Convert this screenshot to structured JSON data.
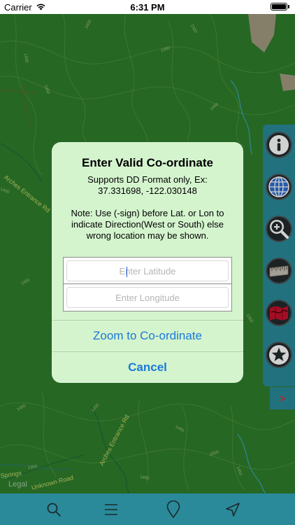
{
  "status_bar": {
    "carrier": "Carrier",
    "time": "6:31 PM",
    "battery_level": 1.0,
    "wifi_icon": "wifi-icon",
    "battery_icon": "battery-icon"
  },
  "map": {
    "road_labels": [
      "Arches Entrance Rd",
      "Arches Entrance Rd",
      "Unknown Road",
      "Springs"
    ],
    "legal": "Legal",
    "contour_labels": [
      "1400",
      "1450",
      "1350",
      "1400",
      "1450",
      "1500",
      "1400",
      "1350",
      "1450",
      "1400",
      "1500",
      "1450",
      "1400",
      "1350",
      "1450",
      "1400"
    ]
  },
  "dialog": {
    "title": "Enter Valid Co-ordinate",
    "format_line1": "Supports DD Format only, Ex:",
    "format_line2": "37.331698, -122.030148",
    "note_line1": "Note: Use (-sign) before Lat. or Lon to",
    "note_line2": "indicate Direction(West or South) else",
    "note_line3": "wrong location may be shown.",
    "latitude_placeholder": "Enter Latitude",
    "longitude_placeholder": "Enter Longitude",
    "latitude_value": "",
    "longitude_value": "",
    "zoom_button": "Zoom to Co-ordinate",
    "cancel_button": "Cancel"
  },
  "side_toolbar": {
    "buttons": [
      "info-icon",
      "globe-icon",
      "zoom-in-icon",
      "ruler-icon",
      "map-layers-icon",
      "star-icon"
    ],
    "expand_label": ">"
  },
  "tab_bar": {
    "buttons": [
      "search-icon",
      "menu-icon",
      "location-pin-icon",
      "navigate-arrow-icon"
    ]
  },
  "colors": {
    "map_green": "#2f7e2d",
    "toolbar_teal": "#2a8a9a",
    "dialog_bg": "#d4f4ce",
    "button_blue": "#1a78d8",
    "expand_red": "#e0303a"
  }
}
